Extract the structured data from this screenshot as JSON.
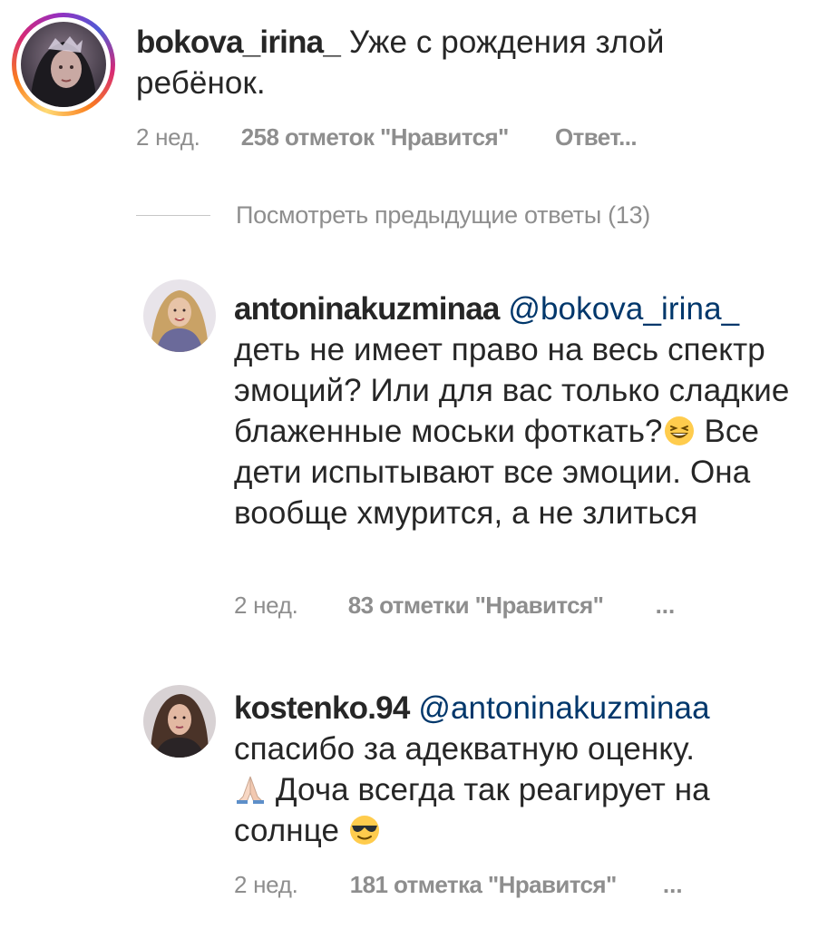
{
  "comments": [
    {
      "username": "bokova_irina_",
      "text": "Уже с рождения злой ребёнок.",
      "time": "2 нед.",
      "likes": "258 отметок \"Нравится\"",
      "reply": "Ответ...",
      "avatar_icon": "user-avatar-with-story-ring"
    },
    {
      "username": "antoninakuzminaa",
      "mention": "@bokova_irina_",
      "text_before_emoji": "деть не имеет право на весь спектр эмоций? Или для вас только сладкие блаженные моськи фоткать?",
      "emoji_1": "grinning-squinting-face-emoji",
      "text_after_emoji": " Все дети испытывают все эмоции. Она вообще хмурится, а не злиться",
      "time": "2 нед.",
      "likes": "83 отметки \"Нравится\"",
      "more": "..."
    },
    {
      "username": "kostenko.94",
      "mention": "@antoninakuzminaa",
      "text_1": "спасибо за адекватную оценку.",
      "emoji_1": "folded-hands-emoji",
      "text_2": " Доча всегда так реагирует на солнце ",
      "emoji_2": "sunglasses-face-emoji",
      "time": "2 нед.",
      "likes": "181 отметка \"Нравится\"",
      "more": "..."
    }
  ],
  "view_previous_replies": "Посмотреть предыдущие ответы (13)",
  "colors": {
    "text": "#262626",
    "meta": "#8e8e8e",
    "mention": "#00376b",
    "divider": "#c7c7c7"
  }
}
